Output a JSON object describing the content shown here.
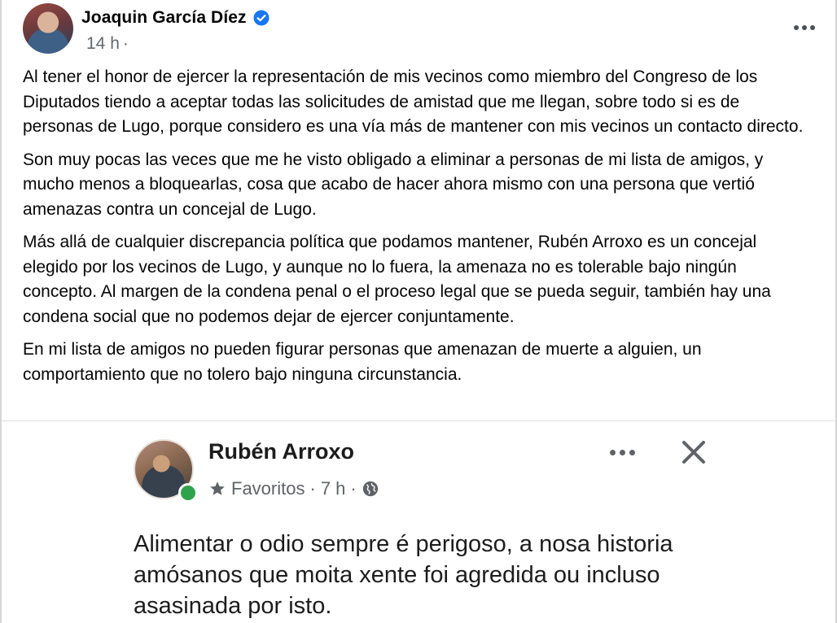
{
  "post": {
    "author": "Joaquin García Díez",
    "time": "14 h",
    "time_separator": "·",
    "paragraphs": [
      "Al tener el honor de ejercer la representación de mis vecinos como miembro del Congreso de los Diputados tiendo a aceptar todas las solicitudes de amistad que me llegan, sobre todo si es de personas de Lugo, porque considero es una vía más de mantener con mis vecinos un contacto directo.",
      "Son muy pocas las veces que me he visto obligado a eliminar a personas de mi lista de amigos, y mucho menos a bloquearlas, cosa que acabo de hacer ahora mismo con una persona que vertió amenazas contra un concejal de Lugo.",
      "Más allá de cualquier discrepancia política que podamos mantener, Rubén Arroxo es un concejal elegido por los vecinos de Lugo, y aunque no lo fuera, la amenaza no es tolerable bajo ningún concepto. Al margen de la condena penal o el proceso legal que se pueda seguir, también hay una condena social que no podemos dejar de ejercer conjuntamente.",
      "En mi lista de amigos no pueden figurar personas que amenazan de muerte a alguien, un comportamiento que no tolero bajo ninguna circunstancia."
    ],
    "icons": {
      "verified": "verified-badge-icon",
      "more": "more-options-icon"
    },
    "colors": {
      "verified": "#1877f2",
      "meta_text": "#65676b"
    }
  },
  "shared_post": {
    "author": "Rubén Arroxo",
    "audience": "Favoritos",
    "time": "7 h",
    "separator": "·",
    "text": "Alimentar o odio sempre é perigoso, a nosa historia amósanos que moita xente foi agredida ou incluso asasinada por isto.",
    "icons": {
      "star": "star-icon",
      "globe": "globe-icon",
      "more": "more-options-icon",
      "close": "close-icon"
    },
    "colors": {
      "online": "#31a24c"
    }
  }
}
